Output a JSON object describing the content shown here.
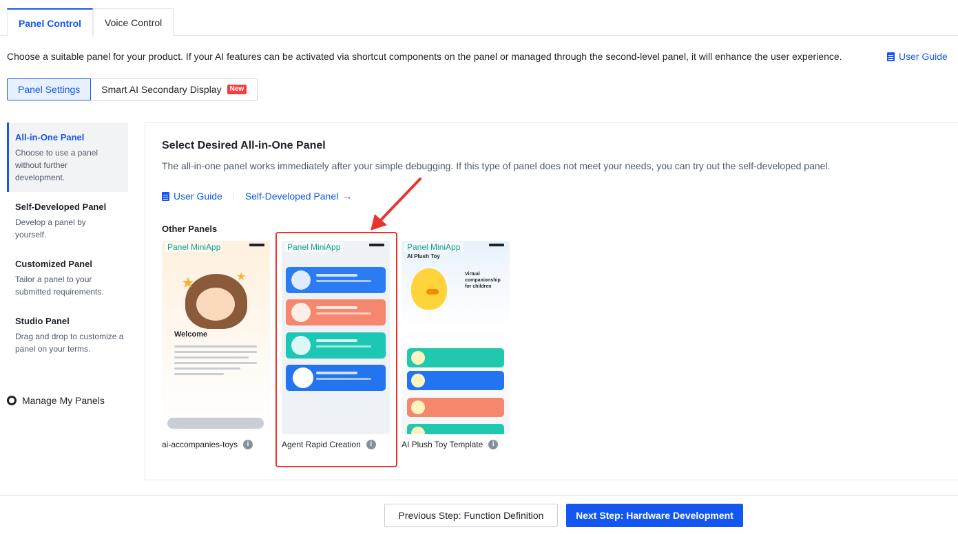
{
  "top_tabs": [
    {
      "label": "Panel Control",
      "active": true
    },
    {
      "label": "Voice Control",
      "active": false
    }
  ],
  "intro_text": "Choose a suitable panel for your product. If your AI features can be activated via shortcut components on the panel or managed through the second-level panel, it will enhance the user experience.",
  "intro_guide_link": "User Guide",
  "segments": [
    {
      "label": "Panel Settings",
      "active": true
    },
    {
      "label": "Smart AI Secondary Display",
      "badge": "New",
      "active": false
    }
  ],
  "sidebar": {
    "items": [
      {
        "title": "All-in-One Panel",
        "desc": "Choose to use a panel without further development.",
        "active": true
      },
      {
        "title": "Self-Developed Panel",
        "desc": "Develop a panel by yourself.",
        "active": false
      },
      {
        "title": "Customized Panel",
        "desc": "Tailor a panel to your submitted requirements.",
        "active": false
      },
      {
        "title": "Studio Panel",
        "desc": "Drag and drop to customize a panel on your terms.",
        "active": false
      }
    ],
    "manage_label": "Manage My Panels"
  },
  "content": {
    "title": "Select Desired All-in-One Panel",
    "desc": "The all-in-one panel works immediately after your simple debugging. If this type of panel does not meet your needs, you can try out the self-developed panel.",
    "guide_link": "User Guide",
    "self_dev_link": "Self-Developed Panel",
    "other_panels_label": "Other Panels",
    "cards": [
      {
        "badge": "Panel MiniApp",
        "label": "ai-accompanies-toys",
        "thumb_heading": "Welcome"
      },
      {
        "badge": "Panel MiniApp",
        "label": "Agent Rapid Creation"
      },
      {
        "badge": "Panel MiniApp",
        "label": "AI Plush Toy Template",
        "thumb_title": "AI Plush Toy",
        "thumb_subtitle": "Virtual companionship for children"
      }
    ]
  },
  "footer": {
    "prev_label": "Previous Step: Function Definition",
    "next_label": "Next Step: Hardware Development"
  },
  "colors": {
    "accent": "#1456f0",
    "highlight": "#e8342f"
  }
}
